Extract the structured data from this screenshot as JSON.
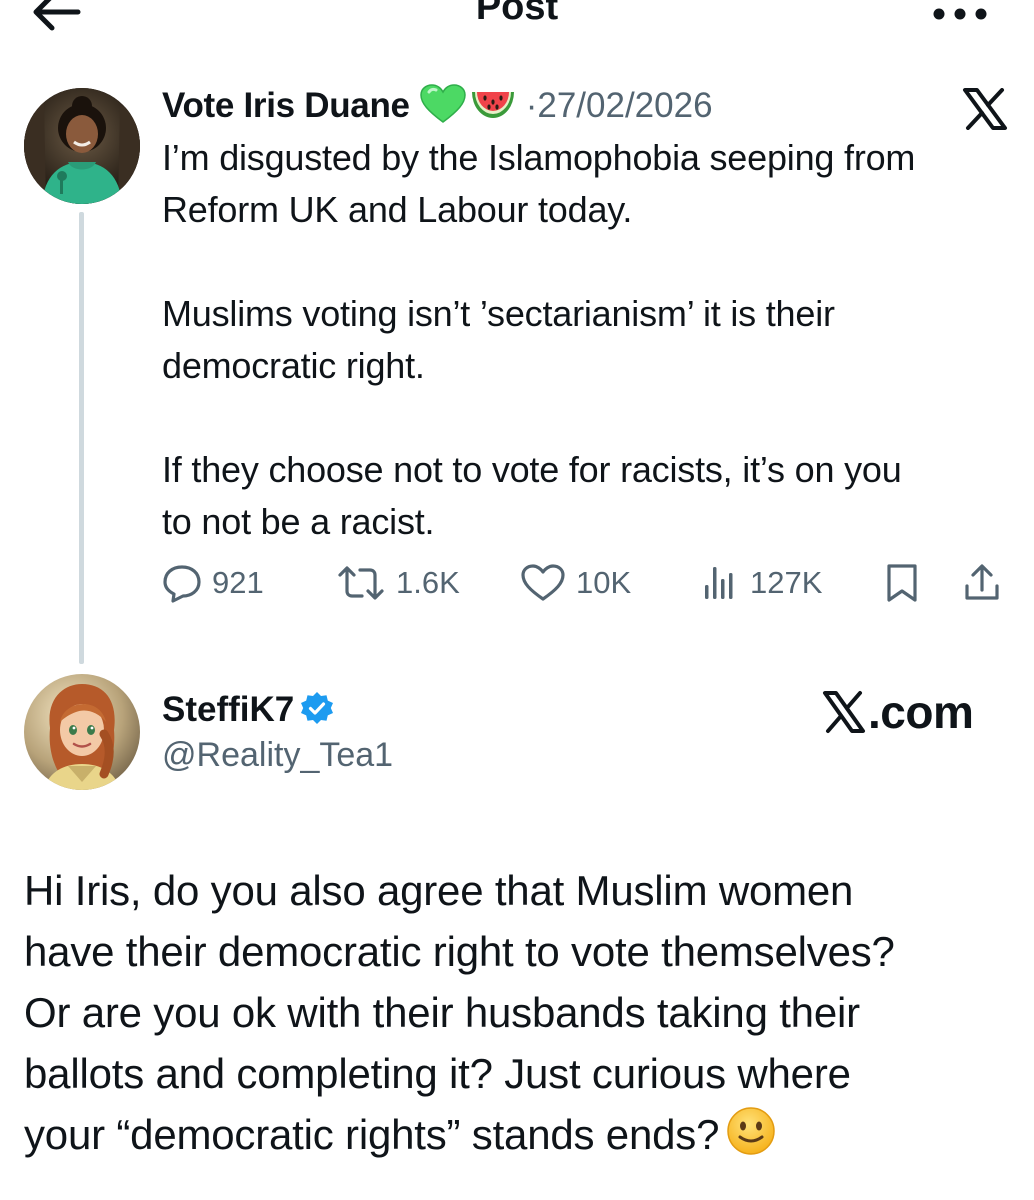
{
  "header": {
    "title": "Post"
  },
  "tweet1": {
    "author_name": "Vote Iris Duane",
    "name_emoji": [
      "green-heart",
      "watermelon"
    ],
    "date": "·27/02/2026",
    "body": [
      "I’m disgusted by the Islamophobia seeping from",
      "Reform UK and Labour today.",
      "",
      "Muslims voting isn’t ’sectarianism’ it is their",
      "democratic right.",
      "",
      "If they choose not to vote for racists, it’s on you",
      "to not be a racist."
    ],
    "metrics": {
      "replies": "921",
      "reposts": "1.6K",
      "likes": "10K",
      "views": "127K"
    }
  },
  "tweet2": {
    "author_name": "SteffiK7",
    "verified": true,
    "handle": "@Reality_Tea1",
    "watermark": ".com",
    "body": [
      "Hi Iris, do you also agree that Muslim women",
      "have their democratic right to vote themselves?",
      "Or are you ok with their husbands taking their",
      "ballots and completing it? Just curious where",
      "your “democratic rights” stands ends?"
    ]
  },
  "colors": {
    "text": "#0f1419",
    "muted": "#536471",
    "thread_line": "#cfd9de",
    "verified_blue": "#1d9bf0",
    "green_heart": "#4cd964"
  }
}
